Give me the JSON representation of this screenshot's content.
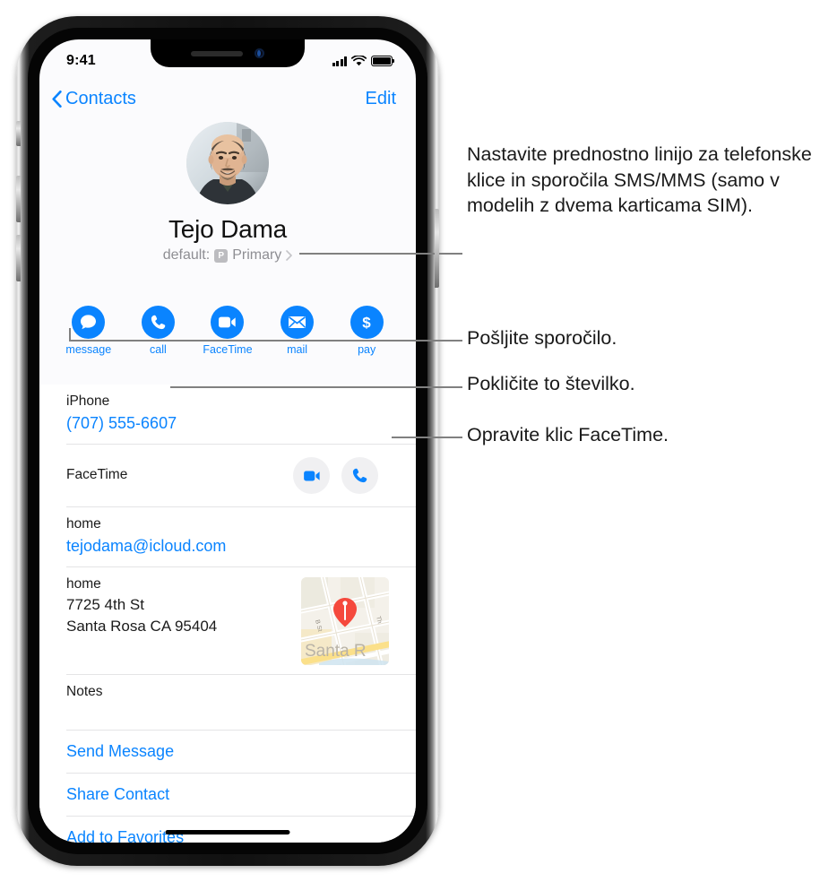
{
  "status_bar": {
    "time": "9:41",
    "cellular_icon": "cellular-bars-icon",
    "wifi_icon": "wifi-icon",
    "battery_icon": "battery-icon"
  },
  "nav_bar": {
    "back_label": "Contacts",
    "back_icon": "chevron-left-icon",
    "edit_label": "Edit"
  },
  "contact": {
    "avatar_icon": "contact-photo",
    "name": "Tejo Dama",
    "default_prefix": "default:",
    "sim_badge": "P",
    "default_value": "Primary",
    "disclosure_icon": "chevron-right-icon"
  },
  "actions": [
    {
      "label": "message",
      "icon": "message-bubble-icon"
    },
    {
      "label": "call",
      "icon": "phone-icon"
    },
    {
      "label": "FaceTime",
      "icon": "video-camera-icon"
    },
    {
      "label": "mail",
      "icon": "envelope-icon"
    },
    {
      "label": "pay",
      "icon": "dollar-sign-icon"
    }
  ],
  "details": {
    "phone": {
      "label": "iPhone",
      "value": "(707) 555-6607"
    },
    "facetime": {
      "label": "FaceTime",
      "video_icon": "video-camera-icon",
      "audio_icon": "phone-icon"
    },
    "email": {
      "label": "home",
      "value": "tejodama@icloud.com"
    },
    "address": {
      "label": "home",
      "street": "7725 4th St",
      "city_state_zip": "Santa Rosa CA 95404",
      "map_icon": "map-thumbnail",
      "map_pin_icon": "map-pin-icon",
      "map_labels": {
        "street_left": "B St",
        "street_right": "Th",
        "city": "Santa R"
      }
    },
    "notes": {
      "label": "Notes"
    }
  },
  "action_links": [
    {
      "label": "Send Message"
    },
    {
      "label": "Share Contact"
    },
    {
      "label": "Add to Favorites"
    }
  ],
  "callouts": {
    "sim": "Nastavite prednostno linijo za telefonske klice in sporočila SMS/MMS (samo v modelih z dvema karticama SIM).",
    "message": "Pošljite sporočilo.",
    "call": "Pokličite to številko.",
    "facetime": "Opravite klic FaceTime."
  },
  "colors": {
    "accent_blue": "#0a84ff",
    "secondary_gray": "#8e8e93",
    "separator": "#e4e4e6",
    "facetime_button_bg": "#f0f0f2",
    "map_pin": "#f5493d"
  }
}
